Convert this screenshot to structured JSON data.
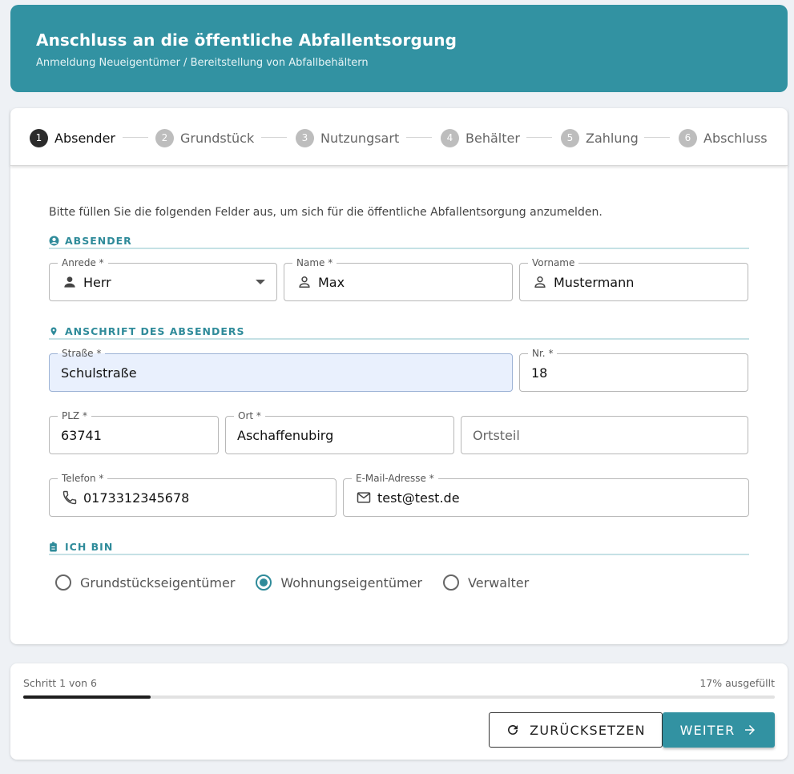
{
  "header": {
    "title": "Anschluss an die öffentliche Abfallentsorgung",
    "subtitle": "Anmeldung Neueigentümer / Bereitstellung von Abfallbehältern"
  },
  "steps": [
    {
      "num": "1",
      "label": "Absender",
      "active": true
    },
    {
      "num": "2",
      "label": "Grundstück",
      "active": false
    },
    {
      "num": "3",
      "label": "Nutzungsart",
      "active": false
    },
    {
      "num": "4",
      "label": "Behälter",
      "active": false
    },
    {
      "num": "5",
      "label": "Zahlung",
      "active": false
    },
    {
      "num": "6",
      "label": "Abschluss",
      "active": false
    }
  ],
  "intro": "Bitte füllen Sie die folgenden Felder aus, um sich für die öffentliche Abfallentsorgung anzumelden.",
  "sections": {
    "absender": "ABSENDER",
    "anschrift": "ANSCHRIFT DES ABSENDERS",
    "ich_bin": "ICH BIN"
  },
  "fields": {
    "anrede": {
      "label": "Anrede *",
      "value": "Herr"
    },
    "name": {
      "label": "Name *",
      "value": "Max"
    },
    "vorname": {
      "label": "Vorname",
      "value": "Mustermann"
    },
    "strasse": {
      "label": "Straße *",
      "value": "Schulstraße"
    },
    "nr": {
      "label": "Nr. *",
      "value": "18"
    },
    "plz": {
      "label": "PLZ *",
      "value": "63741"
    },
    "ort": {
      "label": "Ort *",
      "value": "Aschaffenubirg"
    },
    "ortsteil": {
      "placeholder": "Ortsteil"
    },
    "telefon": {
      "label": "Telefon *",
      "value": "0173312345678"
    },
    "email": {
      "label": "E-Mail-Adresse *",
      "value": "test@test.de"
    }
  },
  "radios": [
    {
      "label": "Grundstückseigentümer",
      "checked": false
    },
    {
      "label": "Wohnungseigentümer",
      "checked": true
    },
    {
      "label": "Verwalter",
      "checked": false
    }
  ],
  "footer": {
    "step_text": "Schritt 1 von 6",
    "percent_text": "17% ausgefüllt",
    "progress": 0.17,
    "reset_label": "ZURÜCKSETZEN",
    "next_label": "WEITER"
  },
  "colors": {
    "accent": "#3292a2",
    "filled_bg": "#e9f0fd"
  }
}
